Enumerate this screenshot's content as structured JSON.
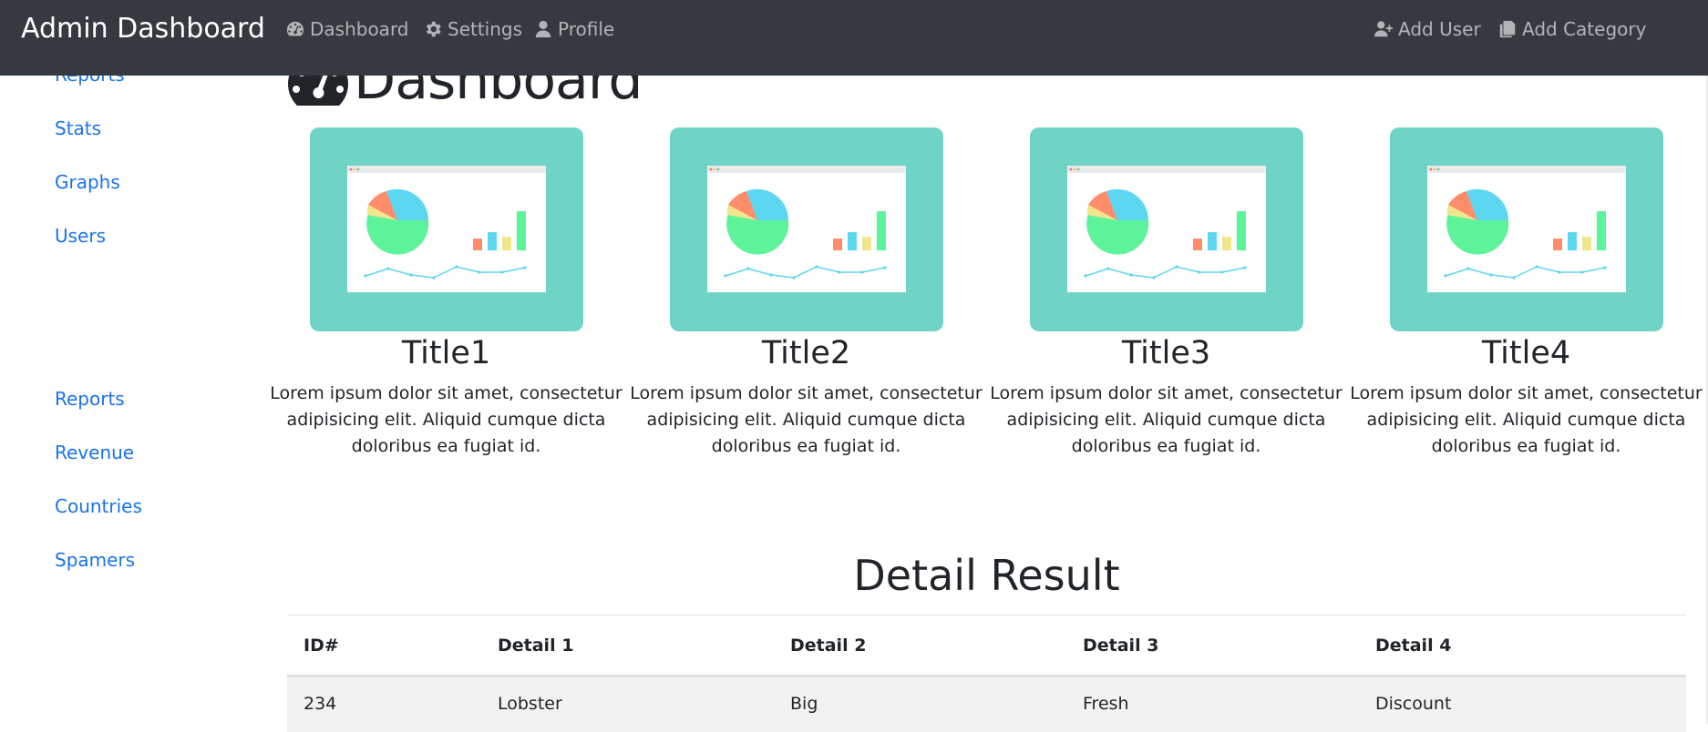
{
  "navbar": {
    "brand": "Admin Dashboard",
    "items": [
      {
        "label": "Dashboard",
        "icon": "tachometer-icon"
      },
      {
        "label": "Settings",
        "icon": "gear-icon"
      },
      {
        "label": "Profile",
        "icon": "user-icon"
      }
    ],
    "actions": [
      {
        "label": "Add User",
        "icon": "user-plus-icon"
      },
      {
        "label": "Add Category",
        "icon": "copy-icon"
      }
    ]
  },
  "sidebar": {
    "group1": [
      "Reports",
      "Stats",
      "Graphs",
      "Users"
    ],
    "group2": [
      "Reports",
      "Revenue",
      "Countries",
      "Spamers"
    ]
  },
  "main": {
    "heading": "Dashboard",
    "heading_icon": "tachometer-icon",
    "cards": [
      {
        "title": "Title1",
        "text": "Lorem ipsum dolor sit amet, consectetur adipisicing elit. Aliquid cumque dicta doloribus ea fugiat id."
      },
      {
        "title": "Title2",
        "text": "Lorem ipsum dolor sit amet, consectetur adipisicing elit. Aliquid cumque dicta doloribus ea fugiat id."
      },
      {
        "title": "Title3",
        "text": "Lorem ipsum dolor sit amet, consectetur adipisicing elit. Aliquid cumque dicta doloribus ea fugiat id."
      },
      {
        "title": "Title4",
        "text": "Lorem ipsum dolor sit amet, consectetur adipisicing elit. Aliquid cumque dicta doloribus ea fugiat id."
      }
    ],
    "detail_title": "Detail Result",
    "table": {
      "headers": [
        "ID#",
        "Detail 1",
        "Detail 2",
        "Detail 3",
        "Detail 4"
      ],
      "rows": [
        [
          "234",
          "Lobster",
          "Big",
          "Fresh",
          "Discount"
        ]
      ]
    }
  },
  "colors": {
    "navbar_bg": "#343a40",
    "link": "#1a73e8",
    "card_bg": "#6fd4c6",
    "row_stripe": "#f2f2f2"
  }
}
